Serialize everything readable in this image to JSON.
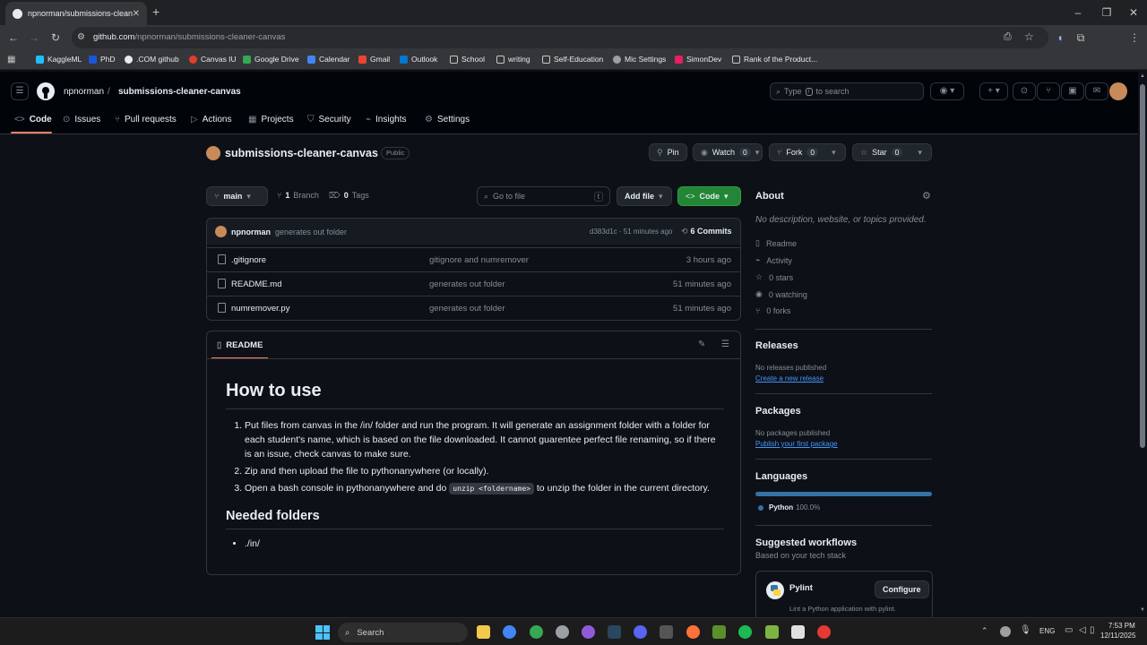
{
  "browser": {
    "tab_title": "npnorman/submissions-cleaner-canvas",
    "url_host": "github.com",
    "url_path": "/npnorman/submissions-cleaner-canvas",
    "bookmarks": [
      "KaggleML",
      "PhD",
      ".COM github",
      "Canvas IU",
      "Google Drive",
      "Calendar",
      "Gmail",
      "Outlook",
      "School",
      "writing",
      "Self-Education",
      "Mic Settings",
      "SimonDev",
      "Rank of the Product..."
    ]
  },
  "header": {
    "owner": "npnorman",
    "separator": "/",
    "repo": "submissions-cleaner-canvas",
    "search_placeholder_pre": "Type",
    "search_key": "/",
    "search_placeholder_post": "to search"
  },
  "nav_tabs": [
    {
      "label": "Code",
      "icon": "code-icon"
    },
    {
      "label": "Issues",
      "icon": "issue-icon"
    },
    {
      "label": "Pull requests",
      "icon": "pull-request-icon"
    },
    {
      "label": "Actions",
      "icon": "actions-icon"
    },
    {
      "label": "Projects",
      "icon": "projects-icon"
    },
    {
      "label": "Security",
      "icon": "shield-icon"
    },
    {
      "label": "Insights",
      "icon": "graph-icon"
    },
    {
      "label": "Settings",
      "icon": "gear-icon"
    }
  ],
  "repo": {
    "name": "submissions-cleaner-canvas",
    "visibility": "Public",
    "pin": "Pin",
    "watch": "Watch",
    "watch_count": "0",
    "fork": "Fork",
    "fork_count": "0",
    "star": "Star",
    "star_count": "0",
    "branch": "main",
    "branch_count": "1",
    "branch_label": "Branch",
    "tag_count": "0",
    "tag_label": "Tags",
    "go_to_file": "Go to file",
    "go_to_file_key": "t",
    "add_file": "Add file",
    "code_button": "Code"
  },
  "commit": {
    "author": "npnorman",
    "message": "generates out folder",
    "hash_time": "d383d1c · 51 minutes ago",
    "commits_label": "6 Commits"
  },
  "files": [
    {
      "name": ".gitignore",
      "message": "gitignore and numremover",
      "time": "3 hours ago"
    },
    {
      "name": "README.md",
      "message": "generates out folder",
      "time": "51 minutes ago"
    },
    {
      "name": "numremover.py",
      "message": "generates out folder",
      "time": "51 minutes ago"
    }
  ],
  "readme": {
    "tab": "README",
    "h1": "How to use",
    "steps": [
      "Put files from canvas in the /in/ folder and run the program. It will generate an assignment folder with a folder for each student's name, which is based on the file downloaded. It cannot guarentee perfect file renaming, so if there is an issue, check canvas to make sure.",
      "Zip and then upload the file to pythonanywhere (or locally)."
    ],
    "step3_pre": "Open a bash console in pythonanywhere and do",
    "step3_code": "unzip <foldername>",
    "step3_post": "to unzip the folder in the current directory.",
    "h2": "Needed folders",
    "folders": [
      "./in/"
    ]
  },
  "about": {
    "title": "About",
    "description": "No description, website, or topics provided.",
    "links": [
      {
        "icon": "book-icon",
        "label": "Readme"
      },
      {
        "icon": "pulse-icon",
        "label": "Activity"
      },
      {
        "icon": "star-icon",
        "label": "0 stars"
      },
      {
        "icon": "eye-icon",
        "label": "0 watching"
      },
      {
        "icon": "fork-icon",
        "label": "0 forks"
      }
    ],
    "releases_title": "Releases",
    "releases_none": "No releases published",
    "releases_link": "Create a new release",
    "packages_title": "Packages",
    "packages_none": "No packages published",
    "packages_link": "Publish your first package",
    "languages_title": "Languages",
    "language": "Python",
    "language_pct": "100.0%",
    "language_fraction": 1.0,
    "language_color": "#3572a5",
    "suggested_title": "Suggested workflows",
    "suggested_sub": "Based on your tech stack",
    "workflow_name": "Pylint",
    "workflow_button": "Configure",
    "workflow_desc": "Lint a Python application with pylint."
  },
  "taskbar": {
    "search": "Search",
    "lang": "ENG",
    "time": "7:53 PM",
    "date": "12/11/2025"
  },
  "colors": {
    "accent_green": "#238636",
    "link_blue": "#4493f8",
    "active_tab_underline": "#f78166"
  }
}
